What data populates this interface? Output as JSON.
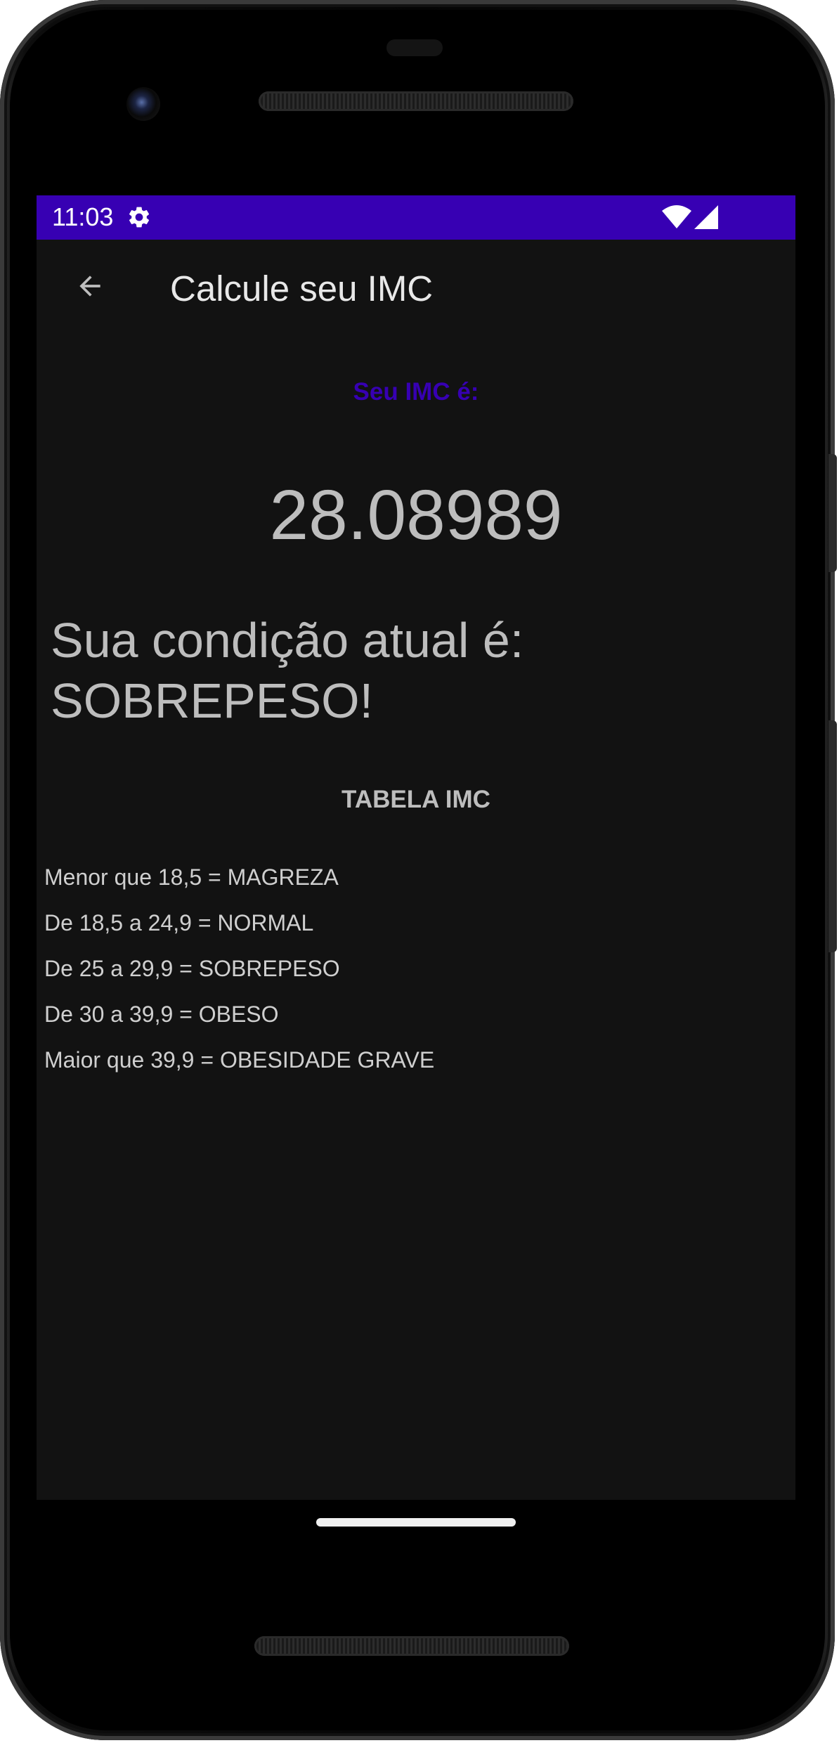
{
  "status_bar": {
    "time": "11:03",
    "background": "#3700b3",
    "icons": [
      "gear-icon",
      "wifi-icon",
      "signal-icon"
    ]
  },
  "app_bar": {
    "title": "Calcule seu IMC",
    "back_icon": "arrow-back-icon"
  },
  "result": {
    "label": "Seu IMC é:",
    "value": "28.08989",
    "condition_line1": "Sua condição atual é:",
    "condition_line2": "SOBREPESO!"
  },
  "table": {
    "title": "TABELA IMC",
    "rows": [
      "Menor que 18,5 = MAGREZA",
      "De 18,5 a 24,9 = NORMAL",
      "De 25 a 29,9 = SOBREPESO",
      "De 30 a 39,9 = OBESO",
      "Maior que 39,9 = OBESIDADE GRAVE"
    ]
  },
  "colors": {
    "accent": "#3700b3",
    "background": "#121212",
    "text": "#bdbdbd"
  }
}
